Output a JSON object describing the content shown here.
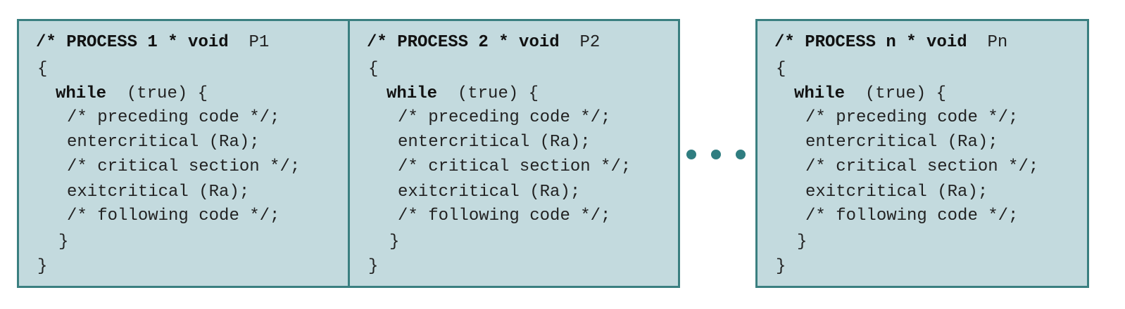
{
  "processes": [
    {
      "header_kw": "/* PROCESS 1 * void",
      "header_name": "P1",
      "open_brace": "{",
      "while_kw": "while",
      "while_cond": "(true) {",
      "preceding": "/* preceding code */;",
      "enter": "entercritical (Ra);",
      "critical": "/* critical section */;",
      "exit": "exitcritical (Ra);",
      "following": "/* following code */;",
      "inner_close": "}",
      "outer_close": "}"
    },
    {
      "header_kw": "/* PROCESS 2 * void",
      "header_name": "P2",
      "open_brace": "{",
      "while_kw": "while",
      "while_cond": "(true) {",
      "preceding": "/* preceding code */;",
      "enter": "entercritical (Ra);",
      "critical": "/* critical section */;",
      "exit": "exitcritical (Ra);",
      "following": "/* following code */;",
      "inner_close": "}",
      "outer_close": "}"
    },
    {
      "header_kw": "/* PROCESS n * void",
      "header_name": "Pn",
      "open_brace": "{",
      "while_kw": "while",
      "while_cond": "(true) {",
      "preceding": "/* preceding code */;",
      "enter": "entercritical (Ra);",
      "critical": "/* critical section */;",
      "exit": "exitcritical (Ra);",
      "following": "/* following code */;",
      "inner_close": "}",
      "outer_close": "}"
    }
  ],
  "colors": {
    "panel_fill": "#c3dade",
    "panel_border": "#3a7f80",
    "ellipsis_dots": "#2f7d80",
    "text": "#222222"
  }
}
